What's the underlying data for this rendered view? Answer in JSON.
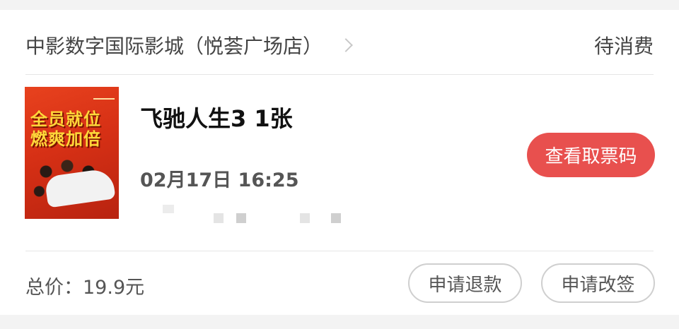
{
  "order": {
    "cinema_name": "中影数字国际影城（悦荟广场店）",
    "status": "待消费",
    "movie_title": "飞驰人生3 1张",
    "poster_text": [
      "全员就位",
      "燃爽加倍"
    ],
    "showtime": "02月17日 16:25",
    "total_label": "总价：19.9元",
    "buttons": {
      "view_ticket_code": "查看取票码",
      "refund": "申请退款",
      "change": "申请改签"
    }
  },
  "colors": {
    "accent": "#e8504e",
    "background": "#f3f3f3"
  }
}
